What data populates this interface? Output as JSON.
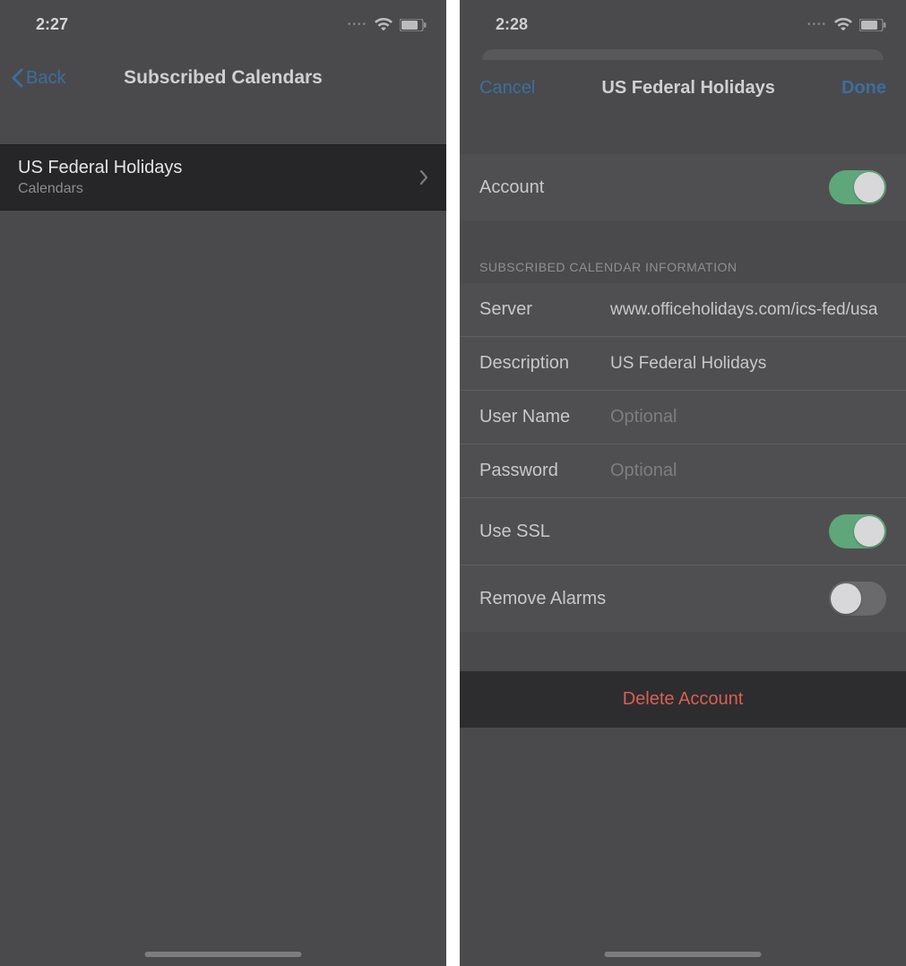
{
  "left": {
    "status_time": "2:27",
    "back_label": "Back",
    "header_title": "Subscribed Calendars",
    "item_title": "US Federal Holidays",
    "item_sub": "Calendars"
  },
  "right": {
    "status_time": "2:28",
    "cancel_label": "Cancel",
    "done_label": "Done",
    "modal_title": "US Federal Holidays",
    "account_label": "Account",
    "account_on": true,
    "section_header": "SUBSCRIBED CALENDAR INFORMATION",
    "server_label": "Server",
    "server_value": "www.officeholidays.com/ics-fed/usa",
    "description_label": "Description",
    "description_value": "US Federal Holidays",
    "username_label": "User Name",
    "username_placeholder": "Optional",
    "password_label": "Password",
    "password_placeholder": "Optional",
    "usessl_label": "Use SSL",
    "usessl_on": true,
    "removealarms_label": "Remove Alarms",
    "removealarms_on": false,
    "delete_label": "Delete Account"
  }
}
